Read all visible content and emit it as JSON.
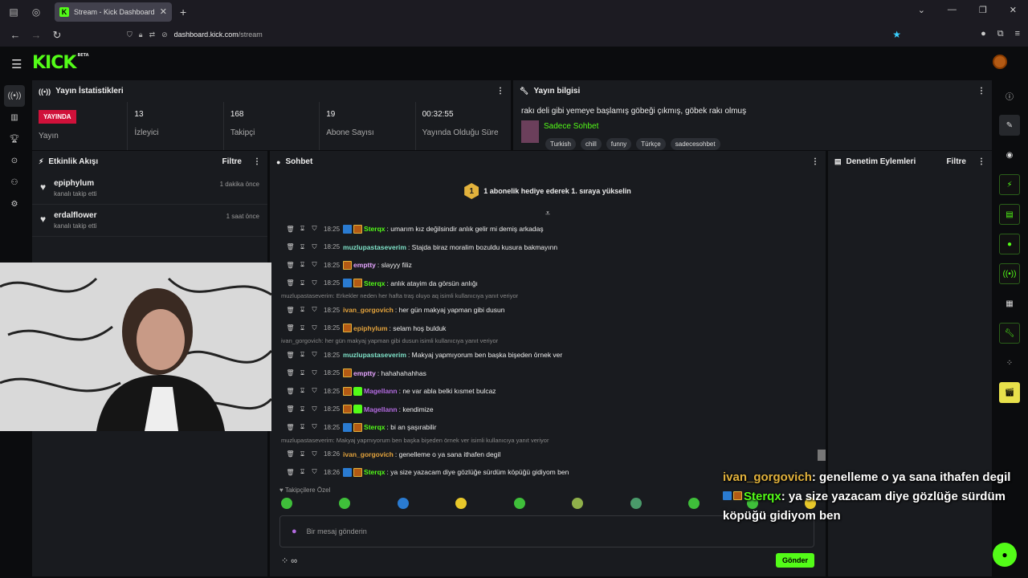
{
  "browser": {
    "tab_title": "Stream - Kick Dashboard",
    "url_host": "dashboard.kick.com",
    "url_path": "/stream"
  },
  "header": {
    "logo": "KICK",
    "logo_badge": "BETA"
  },
  "stats_panel": {
    "title": "Yayın İstatistikleri",
    "live_badge": "YAYINDA",
    "live_label": "Yayın",
    "items": [
      {
        "value": "13",
        "label": "İzleyici"
      },
      {
        "value": "168",
        "label": "Takipçi"
      },
      {
        "value": "19",
        "label": "Abone Sayısı"
      },
      {
        "value": "00:32:55",
        "label": "Yayında Olduğu Süre"
      }
    ]
  },
  "info_panel": {
    "title": "Yayın bilgisi",
    "stream_title": "rakı deli gibi yemeye başlamış göbeği çıkmış, göbek rakı olmuş",
    "category": "Sadece Sohbet",
    "tags": [
      "Turkish",
      "chill",
      "funny",
      "Türkçe",
      "sadecesohbet"
    ]
  },
  "activity_panel": {
    "title": "Etkinlik Akışı",
    "filter": "Filtre",
    "events": [
      {
        "user": "epiphylum",
        "desc": "kanalı takip etti",
        "time": "1 dakika önce"
      },
      {
        "user": "erdalflower",
        "desc": "kanalı takip etti",
        "time": "1 saat önce"
      }
    ]
  },
  "chat_panel": {
    "title": "Sohbet",
    "sub_banner_count": "1",
    "sub_banner_text": "1 abonelik hediye ederek 1. sıraya yükselin",
    "followers_only": "Takipçilere Özel",
    "input_placeholder": "Bir mesaj gönderin",
    "send_label": "Gönder",
    "foot": "∞"
  },
  "mod_panel": {
    "title": "Denetim Eylemleri",
    "filter": "Filtre"
  },
  "messages": [
    {
      "time": "18:25",
      "badges": [
        "blue",
        "org"
      ],
      "name": "Sterqx",
      "color": "#53fc18",
      "text": "umarım kız değilsindir anlık gelir mi demiş arkadaş"
    },
    {
      "time": "18:25",
      "badges": [],
      "name": "muzlupastaseverim",
      "color": "#7fe3c9",
      "text": "Stajda biraz moralim bozuldu kusura bakmayınn"
    },
    {
      "time": "18:25",
      "badges": [
        "org"
      ],
      "name": "emptty",
      "color": "#e6a5ff",
      "text": "slayyy filiz"
    },
    {
      "time": "18:25",
      "badges": [
        "blue",
        "org"
      ],
      "name": "Sterqx",
      "color": "#53fc18",
      "text": "anlık atayim da görsün anlığı"
    },
    {
      "reply": "muzlupastaseverim: Erkekler neden her hafta traş oluyo aq isimli kullanıcıya yanıt veriyor",
      "time": "18:25",
      "badges": [],
      "name": "ivan_gorgovich",
      "color": "#e2a23c",
      "text": "her gün makyaj yapman gibi dusun"
    },
    {
      "time": "18:25",
      "badges": [
        "org"
      ],
      "name": "epiphylum",
      "color": "#e2a23c",
      "text": "selam hoş bulduk"
    },
    {
      "reply": "ivan_gorgovich: her gün makyaj yapman gibi dusun isimli kullanıcıya yanıt veriyor",
      "time": "18:25",
      "badges": [],
      "name": "muzlupastaseverim",
      "color": "#7fe3c9",
      "text": "Makyaj yapmıyorum ben başka bişeden örnek ver"
    },
    {
      "time": "18:25",
      "badges": [
        "org"
      ],
      "name": "emptty",
      "color": "#e6a5ff",
      "text": "hahahahahhas"
    },
    {
      "time": "18:25",
      "badges": [
        "org",
        "grn"
      ],
      "name": "Magellann",
      "color": "#b36be0",
      "text": "ne var abla belki kısmet bulcaz"
    },
    {
      "time": "18:25",
      "badges": [
        "org",
        "grn"
      ],
      "name": "Magellann",
      "color": "#b36be0",
      "text": "kendimize"
    },
    {
      "time": "18:25",
      "badges": [
        "blue",
        "org"
      ],
      "name": "Sterqx",
      "color": "#53fc18",
      "text": "bi an şaşırabilir"
    },
    {
      "reply": "muzlupastaseverim: Makyaj yapmıyorum ben başka bişeden örnek ver isimli kullanıcıya yanıt veriyor",
      "time": "18:26",
      "badges": [],
      "name": "ivan_gorgovich",
      "color": "#e2a23c",
      "text": "genelleme o ya sana ithafen degil"
    },
    {
      "time": "18:26",
      "badges": [
        "blue",
        "org"
      ],
      "name": "Sterqx",
      "color": "#53fc18",
      "text": "ya size yazacam diye gözlüğe sürdüm köpüğü gidiyom ben"
    }
  ],
  "overlay": {
    "line1_name": "ivan_gorgovich",
    "line1_text": ": genelleme o ya sana ithafen degil",
    "line2_name": "Sterqx",
    "line2_text": ": ya size yazacam diye gözlüğe sürdüm köpüğü gidiyom ben"
  }
}
